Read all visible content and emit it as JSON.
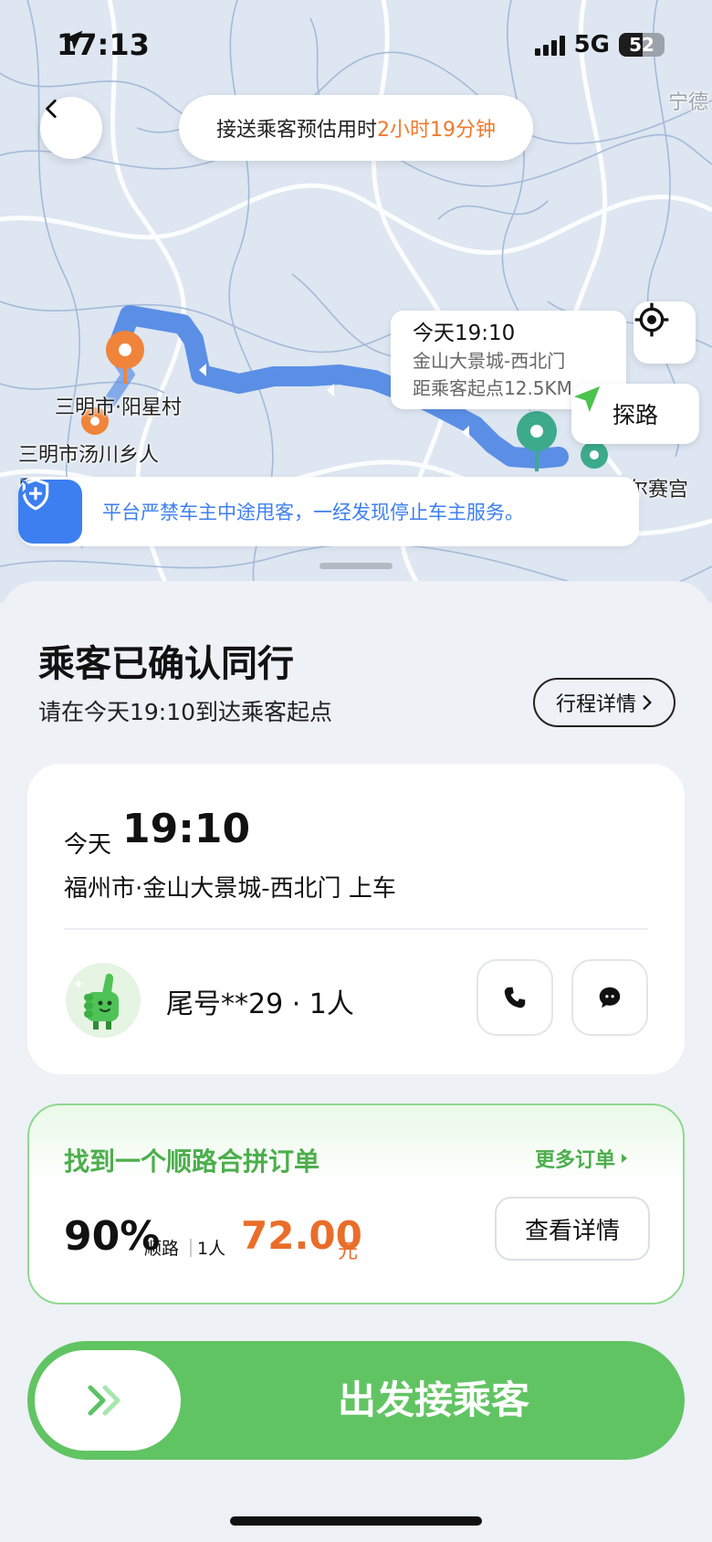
{
  "status_bar": {
    "time": "17:13",
    "network": "5G",
    "battery": "52",
    "battery_level": 0.52
  },
  "map": {
    "eta_prefix": "接送乘客预估用时",
    "eta_value": "2小时19分钟",
    "labels": {
      "yangxing": "三明市·阳星村",
      "tangchuan": "三明市汤川乡人",
      "tangchuan_cut": "民政",
      "saigong": "尔赛宫",
      "ningde": "宁德"
    },
    "callout": {
      "time": "今天19:10",
      "place": "金山大景城-西北门",
      "distance": "距乘客起点12.5KM"
    },
    "explore_label": "探路",
    "colors": {
      "route": "#5b8fe6",
      "origin_pin": "#f0843a",
      "dest_pin": "#3daa8c"
    }
  },
  "notice": {
    "text": "平台严禁车主中途甩客，一经发现停止车主服务。"
  },
  "header": {
    "title": "乘客已确认同行",
    "subtitle": "请在今天19:10到达乘客起点",
    "detail_button": "行程详情"
  },
  "trip_card": {
    "day": "今天",
    "time": "19:10",
    "pickup": "福州市·金山大景城-西北门 上车",
    "passenger": "尾号**29 · 1人"
  },
  "carpool": {
    "title": "找到一个顺路合拼订单",
    "more": "更多订单",
    "match_percent": "90%",
    "match_label": "顺路",
    "people": "1人",
    "price": "72.00",
    "currency": "元",
    "view_button": "查看详情",
    "colors": {
      "accent": "#4cae4c",
      "price": "#ea6d2a"
    }
  },
  "action": {
    "go_label": "出发接乘客",
    "color": "#61c463"
  }
}
